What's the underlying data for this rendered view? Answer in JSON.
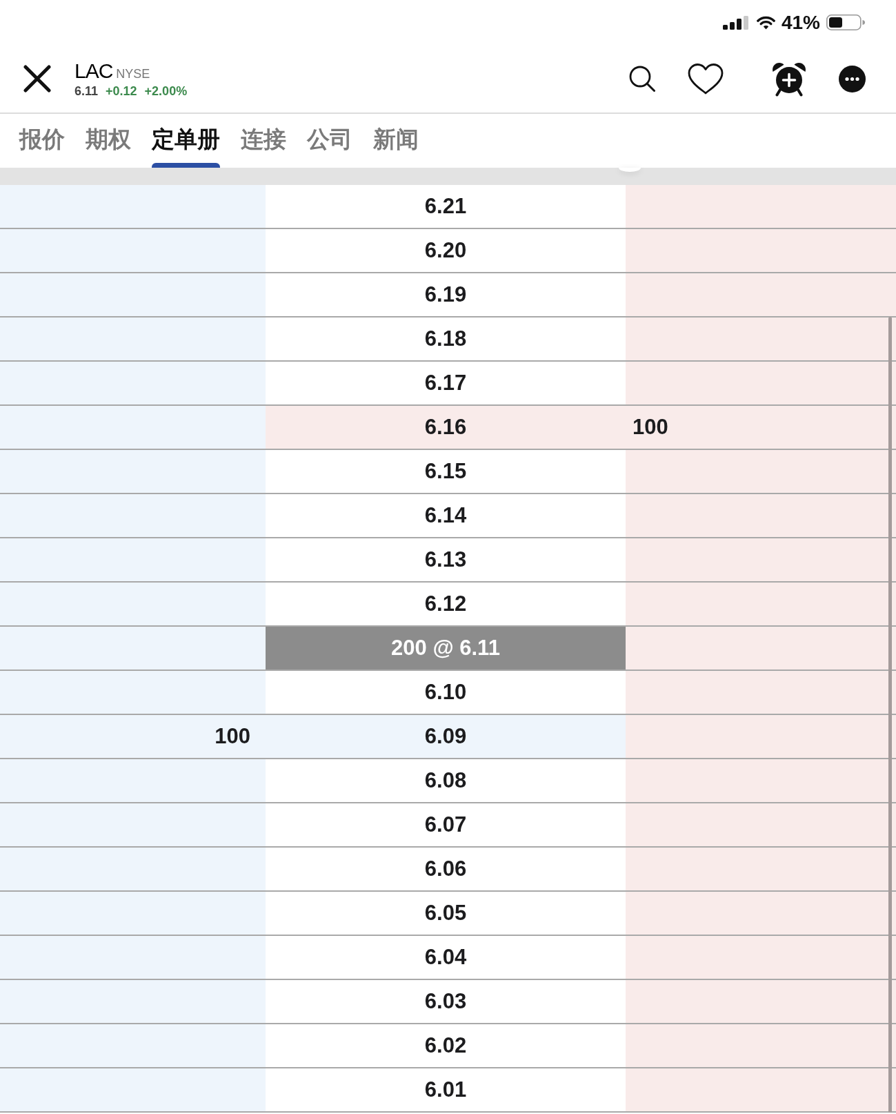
{
  "status_bar": {
    "battery": "41%"
  },
  "header": {
    "symbol": "LAC",
    "exchange": "NYSE",
    "last_price": "6.11",
    "change": "+0.12",
    "change_percent": "+2.00%"
  },
  "tabs": [
    {
      "label": "报价",
      "selected": false
    },
    {
      "label": "期权",
      "selected": false
    },
    {
      "label": "定单册",
      "selected": true
    },
    {
      "label": "连接",
      "selected": false
    },
    {
      "label": "公司",
      "selected": false
    },
    {
      "label": "新闻",
      "selected": false
    }
  ],
  "order_book": {
    "rows": [
      {
        "kind": "level",
        "price": "6.21"
      },
      {
        "kind": "level",
        "price": "6.20"
      },
      {
        "kind": "level",
        "price": "6.19"
      },
      {
        "kind": "level",
        "price": "6.18"
      },
      {
        "kind": "level",
        "price": "6.17"
      },
      {
        "kind": "level",
        "price": "6.16",
        "ask_size": "100"
      },
      {
        "kind": "level",
        "price": "6.15"
      },
      {
        "kind": "level",
        "price": "6.14"
      },
      {
        "kind": "level",
        "price": "6.13"
      },
      {
        "kind": "level",
        "price": "6.12"
      },
      {
        "kind": "last_trade",
        "label": "200 @ 6.11"
      },
      {
        "kind": "level",
        "price": "6.10"
      },
      {
        "kind": "level",
        "price": "6.09",
        "bid_size": "100"
      },
      {
        "kind": "level",
        "price": "6.08"
      },
      {
        "kind": "level",
        "price": "6.07"
      },
      {
        "kind": "level",
        "price": "6.06"
      },
      {
        "kind": "level",
        "price": "6.05"
      },
      {
        "kind": "level",
        "price": "6.04"
      },
      {
        "kind": "level",
        "price": "6.03"
      },
      {
        "kind": "level",
        "price": "6.02"
      },
      {
        "kind": "level",
        "price": "6.01"
      }
    ]
  }
}
